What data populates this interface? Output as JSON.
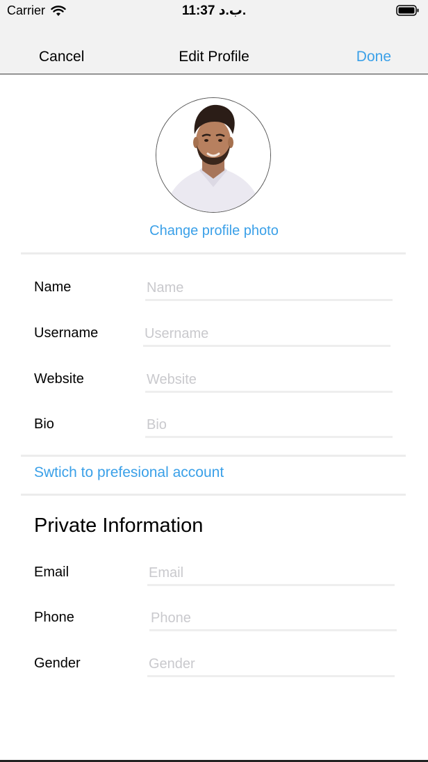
{
  "status_bar": {
    "carrier": "Carrier",
    "time": "11:37 ب.د.",
    "wifi_icon": "wifi-icon",
    "battery_icon": "battery-icon"
  },
  "nav": {
    "cancel_label": "Cancel",
    "title": "Edit Profile",
    "done_label": "Done",
    "accent_color": "#3aa0e8"
  },
  "profile": {
    "avatar_icon": "profile-photo",
    "change_photo_label": "Change profile photo"
  },
  "public_fields": [
    {
      "label": "Name",
      "value": "",
      "placeholder": "Name"
    },
    {
      "label": "Username",
      "value": "",
      "placeholder": "Username"
    },
    {
      "label": "Website",
      "value": "",
      "placeholder": "Website"
    },
    {
      "label": "Bio",
      "value": "",
      "placeholder": "Bio"
    }
  ],
  "switch_account_label": "Swtich to prefesional account",
  "private_section": {
    "title": "Private Information",
    "fields": [
      {
        "label": "Email",
        "value": "",
        "placeholder": "Email"
      },
      {
        "label": "Phone",
        "value": "",
        "placeholder": "Phone"
      },
      {
        "label": "Gender",
        "value": "",
        "placeholder": "Gender"
      }
    ]
  }
}
